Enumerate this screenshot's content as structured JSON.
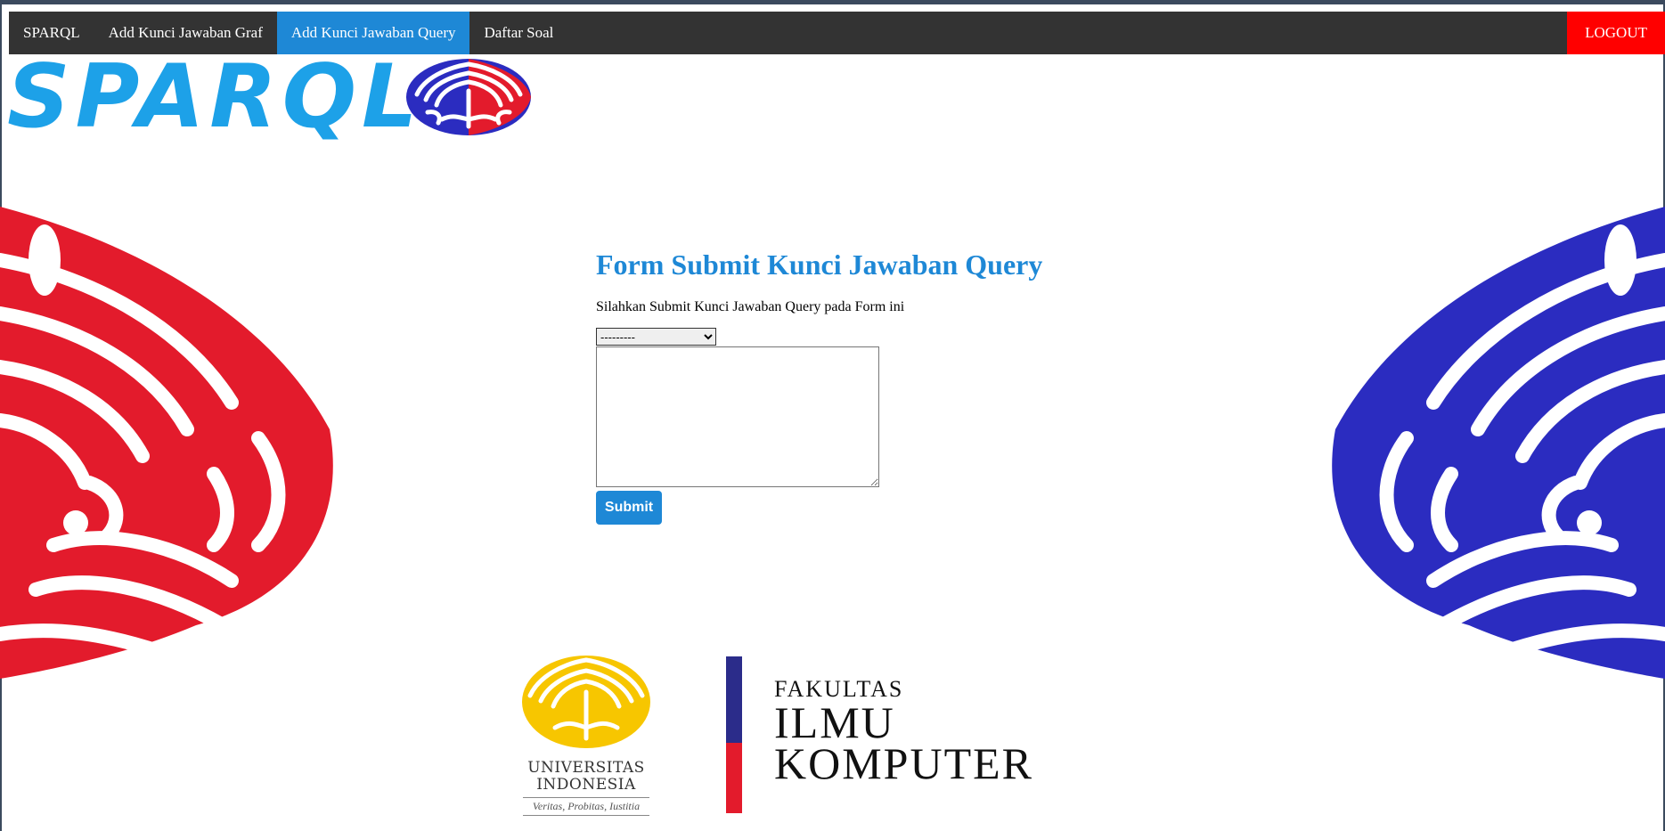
{
  "nav": {
    "items": [
      {
        "label": "SPARQL",
        "active": false
      },
      {
        "label": "Add Kunci Jawaban Graf",
        "active": false
      },
      {
        "label": "Add Kunci Jawaban Query",
        "active": true
      },
      {
        "label": "Daftar Soal",
        "active": false
      }
    ],
    "logout_label": "LOGOUT"
  },
  "brand": {
    "logo_text": "SPARQL",
    "emblem_icon": "makara-emblem-icon"
  },
  "form": {
    "title": "Form Submit Kunci Jawaban Query",
    "subtitle": "Silahkan Submit Kunci Jawaban Query pada Form ini",
    "select_value": "---------",
    "textarea_value": "",
    "submit_label": "Submit"
  },
  "footer": {
    "ui_name_line1": "UNIVERSITAS",
    "ui_name_line2": "INDONESIA",
    "ui_motto": "Veritas, Probitas, Iustitia",
    "faculty_line1": "FAKULTAS",
    "faculty_line2": "ILMU",
    "faculty_line3": "KOMPUTER"
  },
  "colors": {
    "nav_bg": "#333333",
    "nav_active": "#1e88d6",
    "logout_bg": "#ff0000",
    "accent_blue": "#1e88d6",
    "makara_red": "#e31b2c",
    "makara_blue": "#2b2cc0",
    "makara_gold": "#f7c600"
  }
}
